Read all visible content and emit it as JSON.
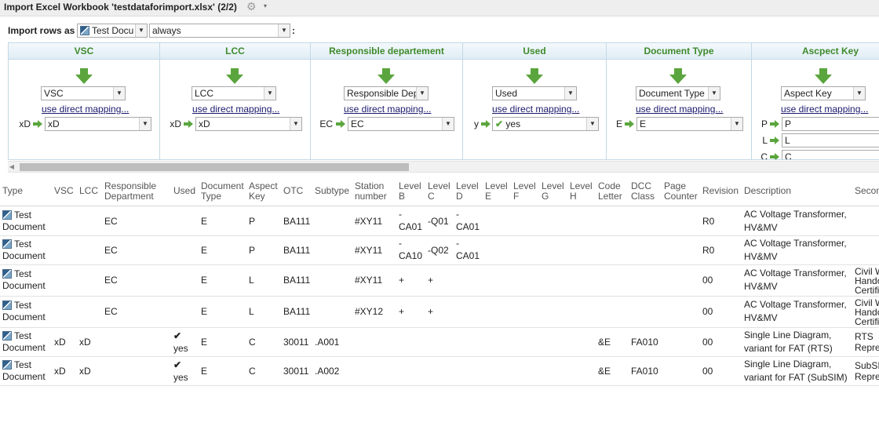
{
  "window": {
    "title": "Import Excel Workbook 'testdataforimport.xlsx' (2/2)",
    "gear_icon": "gear-icon",
    "menu_caret": "▾"
  },
  "import_rows": {
    "label": "Import rows as",
    "type_value": "Test Docu",
    "mode_value": "always",
    "colon": ":"
  },
  "mapping_link": "use direct mapping...",
  "mapping_columns": [
    {
      "header": "VSC",
      "target": "VSC",
      "rows": [
        {
          "src": "xD",
          "dst": "xD"
        }
      ]
    },
    {
      "header": "LCC",
      "target": "LCC",
      "rows": [
        {
          "src": "xD",
          "dst": "xD"
        }
      ]
    },
    {
      "header": "Responsible departement",
      "target": "Responsible Dep",
      "rows": [
        {
          "src": "EC",
          "dst": "EC"
        }
      ]
    },
    {
      "header": "Used",
      "target": "Used",
      "rows": [
        {
          "src": "y",
          "dst": "yes"
        }
      ]
    },
    {
      "header": "Document Type",
      "target": "Document Type",
      "rows": [
        {
          "src": "E",
          "dst": "E"
        }
      ]
    },
    {
      "header": "Ascpect Key",
      "target": "Aspect Key",
      "rows": [
        {
          "src": "P",
          "dst": "P"
        },
        {
          "src": "L",
          "dst": "L"
        },
        {
          "src": "C",
          "dst": "C"
        }
      ]
    }
  ],
  "table": {
    "headers": {
      "type": "Type",
      "vsc": "VSC",
      "lcc": "LCC",
      "resp1": "Responsible",
      "resp2": "Department",
      "used": "Used",
      "doctype1": "Document",
      "doctype2": "Type",
      "aspect1": "Aspect",
      "aspect2": "Key",
      "otc": "OTC",
      "subtype": "Subtype",
      "station1": "Station",
      "station2": "number",
      "levelb1": "Level",
      "levelb2": "B",
      "levelc1": "Level",
      "levelc2": "C",
      "leveld1": "Level",
      "leveld2": "D",
      "levele1": "Level",
      "levele2": "E",
      "levelf1": "Level",
      "levelf2": "F",
      "levelg1": "Level",
      "levelg2": "G",
      "levelh1": "Level",
      "levelh2": "H",
      "code1": "Code",
      "code2": "Letter",
      "dcc1": "DCC",
      "dcc2": "Class",
      "page1": "Page",
      "page2": "Counter",
      "revision": "Revision",
      "description": "Description",
      "second": "Secon"
    },
    "rows": [
      {
        "type1": "Test",
        "type2": "Document",
        "vsc": "",
        "lcc": "",
        "resp": "EC",
        "used": "",
        "used_check": false,
        "doctype": "E",
        "aspect": "P",
        "otc": "BA111",
        "subtype": "",
        "station": "#XY11",
        "lb1": "-",
        "lb2": "CA01",
        "lc1": "-Q01",
        "lc2": "",
        "ld1": "-",
        "ld2": "CA01",
        "code": "",
        "dcc": "",
        "revision": "R0",
        "desc1": "AC Voltage Transformer,",
        "desc2": "HV&MV",
        "sec1": "",
        "sec2": "",
        "sec3": ""
      },
      {
        "type1": "Test",
        "type2": "Document",
        "vsc": "",
        "lcc": "",
        "resp": "EC",
        "used": "",
        "used_check": false,
        "doctype": "E",
        "aspect": "P",
        "otc": "BA111",
        "subtype": "",
        "station": "#XY11",
        "lb1": "-",
        "lb2": "CA10",
        "lc1": "-Q02",
        "lc2": "",
        "ld1": "-",
        "ld2": "CA01",
        "code": "",
        "dcc": "",
        "revision": "R0",
        "desc1": "AC Voltage Transformer,",
        "desc2": "HV&MV",
        "sec1": "",
        "sec2": "",
        "sec3": ""
      },
      {
        "type1": "Test",
        "type2": "Document",
        "vsc": "",
        "lcc": "",
        "resp": "EC",
        "used": "",
        "used_check": false,
        "doctype": "E",
        "aspect": "L",
        "otc": "BA111",
        "subtype": "",
        "station": "#XY11",
        "lb1": "+",
        "lb2": "",
        "lc1": "+",
        "lc2": "",
        "ld1": "",
        "ld2": "",
        "code": "",
        "dcc": "",
        "revision": "00",
        "desc1": "AC Voltage Transformer,",
        "desc2": "HV&MV",
        "sec1": "Civil W",
        "sec2": "Hando",
        "sec3": "Certifi"
      },
      {
        "type1": "Test",
        "type2": "Document",
        "vsc": "",
        "lcc": "",
        "resp": "EC",
        "used": "",
        "used_check": false,
        "doctype": "E",
        "aspect": "L",
        "otc": "BA111",
        "subtype": "",
        "station": "#XY12",
        "lb1": "+",
        "lb2": "",
        "lc1": "+",
        "lc2": "",
        "ld1": "",
        "ld2": "",
        "code": "",
        "dcc": "",
        "revision": "00",
        "desc1": "AC Voltage Transformer,",
        "desc2": "HV&MV",
        "sec1": "Civil W",
        "sec2": "Hando",
        "sec3": "Certifi"
      },
      {
        "type1": "Test",
        "type2": "Document",
        "vsc": "xD",
        "lcc": "xD",
        "resp": "",
        "used": "yes",
        "used_check": true,
        "doctype": "E",
        "aspect": "C",
        "otc": "30011",
        "subtype": ".A001",
        "station": "",
        "lb1": "",
        "lb2": "",
        "lc1": "",
        "lc2": "",
        "ld1": "",
        "ld2": "",
        "code": "&E",
        "dcc": "FA010",
        "revision": "00",
        "desc1": "Single Line Diagram,",
        "desc2": "variant for FAT (RTS)",
        "sec1": "RTS",
        "sec2": "Repre",
        "sec3": ""
      },
      {
        "type1": "Test",
        "type2": "Document",
        "vsc": "xD",
        "lcc": "xD",
        "resp": "",
        "used": "yes",
        "used_check": true,
        "doctype": "E",
        "aspect": "C",
        "otc": "30011",
        "subtype": ".A002",
        "station": "",
        "lb1": "",
        "lb2": "",
        "lc1": "",
        "lc2": "",
        "ld1": "",
        "ld2": "",
        "code": "&E",
        "dcc": "FA010",
        "revision": "00",
        "desc1": "Single Line Diagram,",
        "desc2": "variant for FAT (SubSIM)",
        "sec1": "SubSI",
        "sec2": "Repre",
        "sec3": ""
      }
    ]
  },
  "colors": {
    "accent_green": "#5aa53d",
    "header_green": "#3f8a2c",
    "link_blue": "#1a1a6e",
    "panel_border": "#c4d8e6"
  }
}
